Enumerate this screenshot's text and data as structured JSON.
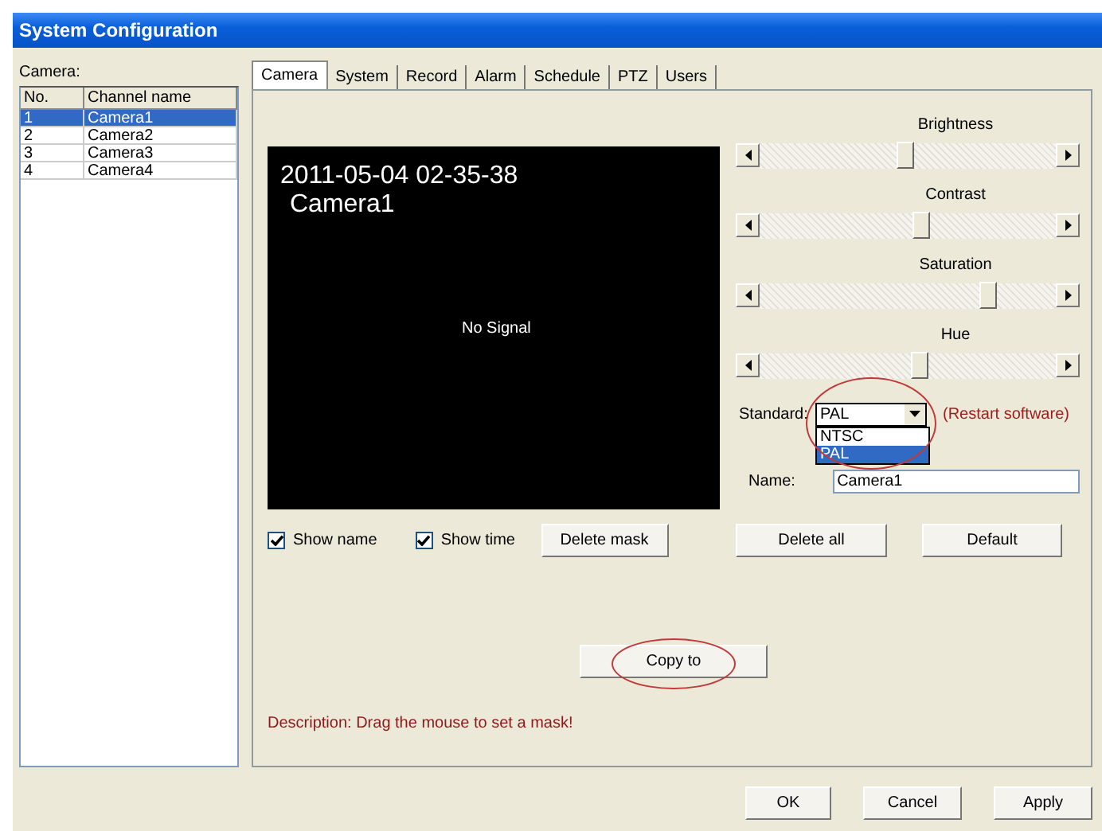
{
  "window": {
    "title": "System Configuration"
  },
  "camera_list": {
    "label": "Camera:",
    "columns": [
      "No.",
      "Channel name"
    ],
    "rows": [
      {
        "cells": [
          "1",
          "Camera1"
        ],
        "selected": true
      },
      {
        "cells": [
          "2",
          "Camera2"
        ],
        "selected": false
      },
      {
        "cells": [
          "3",
          "Camera3"
        ],
        "selected": false
      },
      {
        "cells": [
          "4",
          "Camera4"
        ],
        "selected": false
      }
    ]
  },
  "tabs": [
    {
      "label": "Camera",
      "selected": true
    },
    {
      "label": "System",
      "selected": false
    },
    {
      "label": "Record",
      "selected": false
    },
    {
      "label": "Alarm",
      "selected": false
    },
    {
      "label": "Schedule",
      "selected": false
    },
    {
      "label": "PTZ",
      "selected": false
    },
    {
      "label": "Users",
      "selected": false
    }
  ],
  "preview": {
    "timestamp": "2011-05-04 02-35-38",
    "camera_name": "Camera1",
    "message": "No Signal"
  },
  "adjustments": [
    {
      "label": "Brightness",
      "level": 0.49
    },
    {
      "label": "Contrast",
      "level": 0.55
    },
    {
      "label": "Saturation",
      "level": 0.79
    },
    {
      "label": "Hue",
      "level": 0.54
    }
  ],
  "standard": {
    "label": "Standard:",
    "value": "PAL",
    "expanded": true,
    "highlighted": true,
    "note": "(Restart software)",
    "options": [
      {
        "label": "NTSC",
        "selected": false
      },
      {
        "label": "PAL",
        "selected": true
      }
    ]
  },
  "name_field": {
    "label": "Name:",
    "value": "Camera1"
  },
  "options": [
    {
      "label": "Show name",
      "checked": true
    },
    {
      "label": "Show time",
      "checked": true
    }
  ],
  "row_buttons": [
    "Delete mask",
    "Delete all",
    "Default"
  ],
  "copy_button": {
    "label": "Copy to",
    "highlighted": true
  },
  "description": "Description: Drag the mouse to set a mask!",
  "dialog_buttons": [
    "OK",
    "Cancel",
    "Apply"
  ]
}
